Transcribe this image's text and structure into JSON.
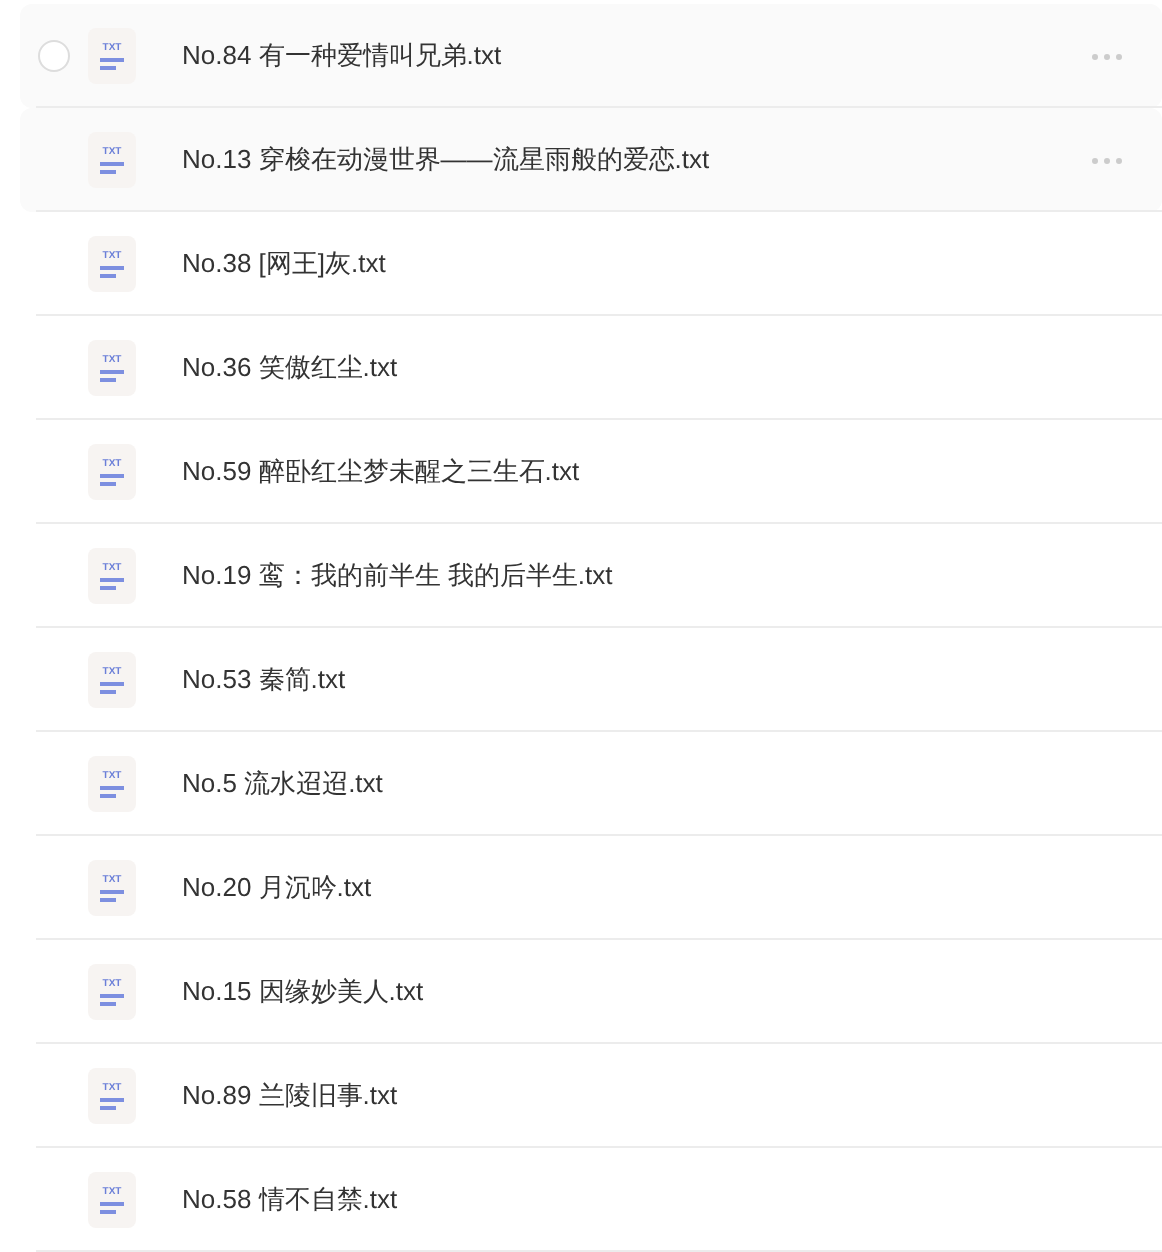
{
  "files": [
    {
      "name": "No.84 有一种爱情叫兄弟.txt",
      "icon_label": "TXT",
      "hovered": true,
      "checkbox_visible": true
    },
    {
      "name": "No.13 穿梭在动漫世界——流星雨般的爱恋.txt",
      "icon_label": "TXT",
      "hovered": true,
      "checkbox_visible": false
    },
    {
      "name": "No.38 [网王]灰.txt",
      "icon_label": "TXT",
      "hovered": false,
      "checkbox_visible": false
    },
    {
      "name": "No.36 笑傲红尘.txt",
      "icon_label": "TXT",
      "hovered": false,
      "checkbox_visible": false
    },
    {
      "name": "No.59 醉卧红尘梦未醒之三生石.txt",
      "icon_label": "TXT",
      "hovered": false,
      "checkbox_visible": false
    },
    {
      "name": "No.19 鸾：我的前半生 我的后半生.txt",
      "icon_label": "TXT",
      "hovered": false,
      "checkbox_visible": false
    },
    {
      "name": "No.53 秦简.txt",
      "icon_label": "TXT",
      "hovered": false,
      "checkbox_visible": false
    },
    {
      "name": "No.5 流水迢迢.txt",
      "icon_label": "TXT",
      "hovered": false,
      "checkbox_visible": false
    },
    {
      "name": "No.20 月沉吟.txt",
      "icon_label": "TXT",
      "hovered": false,
      "checkbox_visible": false
    },
    {
      "name": "No.15 因缘妙美人.txt",
      "icon_label": "TXT",
      "hovered": false,
      "checkbox_visible": false
    },
    {
      "name": "No.89 兰陵旧事.txt",
      "icon_label": "TXT",
      "hovered": false,
      "checkbox_visible": false
    },
    {
      "name": "No.58 情不自禁.txt",
      "icon_label": "TXT",
      "hovered": false,
      "checkbox_visible": false
    }
  ]
}
